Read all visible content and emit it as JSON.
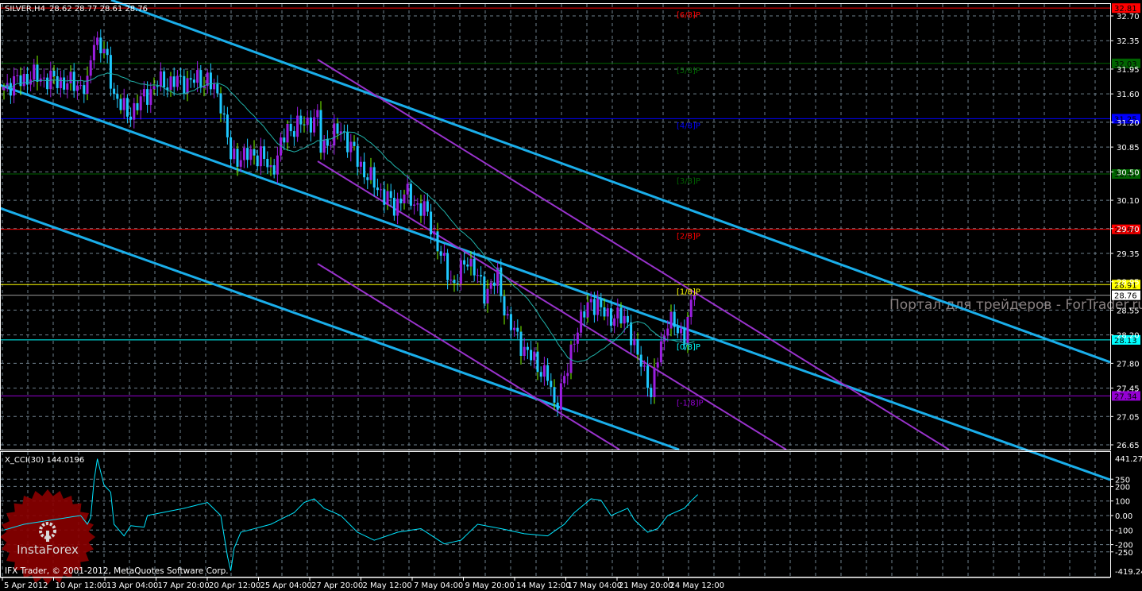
{
  "header": {
    "symbol": "SILVER,H4",
    "ohlc": "28.62 28.77 28.61 28.76"
  },
  "indicator": {
    "label": "X_CCI(30) 144.0196"
  },
  "copyright": "IFX Trader, © 2001-2012, MetaQuotes Software Corp.",
  "watermark": {
    "logo_text": "InstaForex",
    "portal_text": "Портал для трейдеров - ForTrader.ru"
  },
  "colors": {
    "background": "#000000",
    "up_candle": "#9a1ee0",
    "down_candle": "#1ec8ff",
    "ma": "#20b2aa",
    "channel": "#1aaeea",
    "pitch": "#9932cc",
    "cci": "#00e5ff"
  },
  "chart_data": [
    {
      "type": "candlestick",
      "title": "SILVER,H4",
      "ylim": [
        26.65,
        32.7
      ],
      "y_ticks": [
        "32.70",
        "32.35",
        "31.95",
        "31.60",
        "31.20",
        "30.85",
        "30.50",
        "30.10",
        "29.70",
        "29.35",
        "28.95",
        "28.55",
        "28.20",
        "27.80",
        "27.45",
        "27.05",
        "26.65"
      ],
      "x_ticks": [
        "5 Apr 2012",
        "10 Apr 12:00",
        "13 Apr 04:00",
        "17 Apr 20:00",
        "20 Apr 12:00",
        "25 Apr 04:00",
        "27 Apr 20:00",
        "2 May 12:00",
        "7 May 04:00",
        "9 May 20:00",
        "14 May 12:00",
        "17 May 04:00",
        "21 May 20:00",
        "24 May 12:00"
      ],
      "bar_count": 208,
      "close_keyframes": {
        "bar": [
          0,
          8,
          25,
          27,
          30,
          33,
          37,
          46,
          61,
          65,
          68,
          77,
          80,
          85,
          94,
          95,
          101,
          108,
          117,
          120,
          127,
          131,
          135,
          139,
          144,
          148,
          151,
          156,
          163,
          165,
          169,
          171,
          176,
          180,
          187,
          189,
          193,
          194,
          196,
          199,
          204,
          207
        ],
        "close": [
          31.7,
          31.85,
          31.7,
          32.4,
          32.2,
          31.6,
          31.3,
          31.75,
          31.8,
          31.5,
          30.7,
          30.75,
          30.5,
          31.1,
          31.25,
          30.85,
          31.1,
          30.5,
          30.0,
          30.2,
          29.9,
          29.3,
          28.9,
          29.3,
          28.8,
          29.0,
          28.4,
          28.0,
          27.6,
          27.2,
          27.7,
          28.2,
          28.7,
          28.5,
          28.4,
          28.0,
          27.6,
          27.3,
          27.9,
          28.4,
          28.2,
          28.76
        ]
      },
      "ma_period": 21,
      "levels": [
        {
          "label": "[6/8]P",
          "value": 32.81,
          "color": "#ff0000"
        },
        {
          "label": "[5/8]P",
          "value": 32.03,
          "color": "#006400"
        },
        {
          "label": "[4/8]P",
          "value": 31.25,
          "color": "#0000ff"
        },
        {
          "label": "[3/8]P",
          "value": 30.47,
          "color": "#006400"
        },
        {
          "label": "[2/8]P",
          "value": 29.69,
          "color": "#ff0000"
        },
        {
          "label": "[1/8]P",
          "value": 28.91,
          "color": "#ffff00"
        },
        {
          "label": "[0/8]P",
          "value": 28.13,
          "color": "#00ffff"
        },
        {
          "label": "[-1/8]P",
          "value": 27.34,
          "color": "#9400d3"
        }
      ],
      "current_price": {
        "label": "28.76",
        "value": 28.76
      },
      "level_values": [
        "32.81",
        "32.03",
        "31.25",
        "30.47",
        "29.69",
        "28.91",
        "28.13",
        "27.34"
      ]
    },
    {
      "type": "line",
      "title": "X_CCI(30)",
      "ylim": [
        -419.246,
        441.274
      ],
      "y_ticks": [
        "441.274",
        "250",
        "200",
        "100",
        "0.00",
        "-100",
        "-200",
        "-250",
        "-419.246"
      ],
      "y_tick_values": [
        441.274,
        250,
        200,
        100,
        0,
        -100,
        -200,
        -250,
        -419.246
      ],
      "keyframes": {
        "bar": [
          0,
          6,
          13,
          23,
          25,
          26,
          27,
          28,
          30,
          32,
          33,
          36,
          38,
          42,
          43,
          54,
          61,
          65,
          67,
          68,
          69,
          71,
          80,
          87,
          90,
          93,
          96,
          101,
          106,
          111,
          118,
          125,
          132,
          137,
          142,
          149,
          156,
          163,
          168,
          171,
          176,
          179,
          182,
          187,
          189,
          193,
          196,
          199,
          204,
          206,
          208
        ],
        "value": [
          -100,
          -60,
          -35,
          0,
          -60,
          -15,
          240,
          390,
          210,
          160,
          -60,
          -140,
          -70,
          -80,
          0,
          50,
          90,
          0,
          -280,
          -380,
          -225,
          -115,
          -60,
          20,
          90,
          115,
          50,
          0,
          -115,
          -170,
          -115,
          -90,
          -195,
          -170,
          -60,
          -90,
          -125,
          -140,
          -60,
          20,
          115,
          105,
          0,
          50,
          -30,
          -115,
          -90,
          0,
          50,
          100,
          144
        ]
      }
    }
  ]
}
